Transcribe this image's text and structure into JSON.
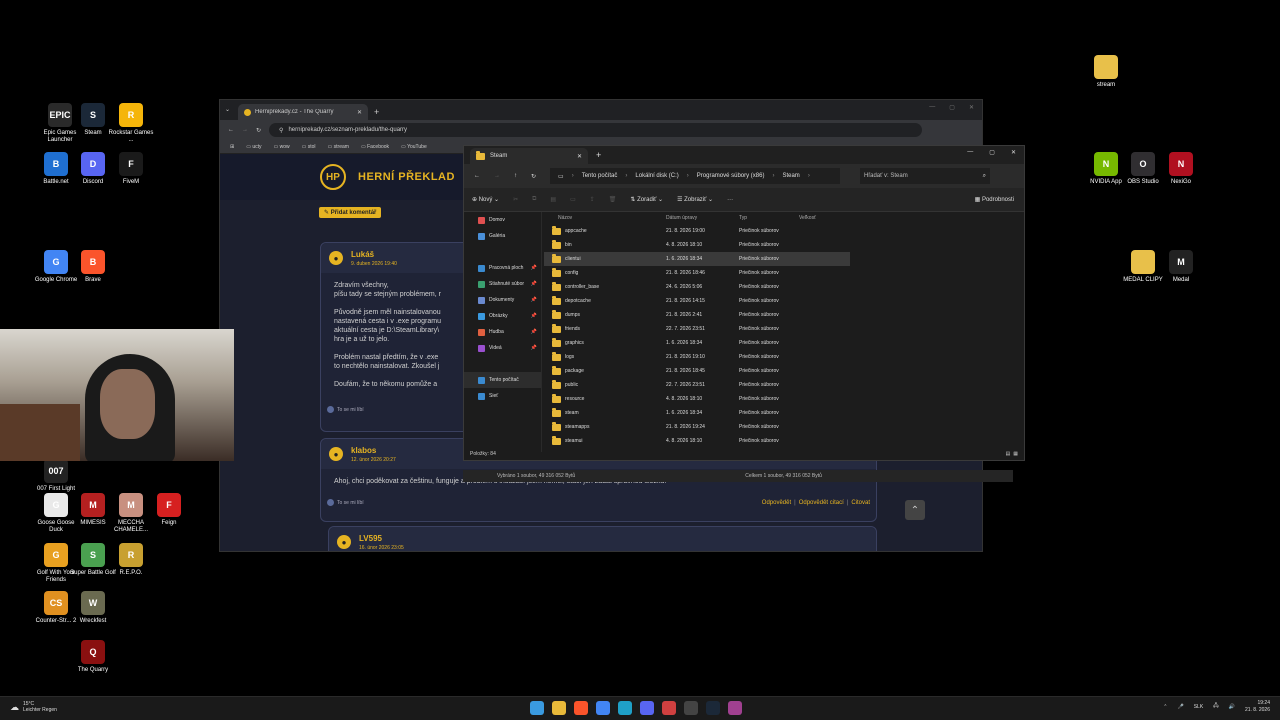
{
  "desktop": {
    "icons_left": [
      {
        "label": "Epic Games Launcher",
        "color": "#2a2a2a",
        "glyph": "EPIC"
      },
      {
        "label": "Steam",
        "color": "#1b2838",
        "glyph": "S"
      },
      {
        "label": "Rockstar Games ...",
        "color": "#f5b50a",
        "glyph": "R"
      },
      {
        "label": "Battle.net",
        "color": "#1f6fd1",
        "glyph": "B"
      },
      {
        "label": "Discord",
        "color": "#5865f2",
        "glyph": "D"
      },
      {
        "label": "FiveM",
        "color": "#1a1a1a",
        "glyph": "F"
      },
      {
        "label": "Google Chrome",
        "color": "#4285f4",
        "glyph": "G"
      },
      {
        "label": "Brave",
        "color": "#fb542b",
        "glyph": "B"
      },
      {
        "label": "007 First Light",
        "color": "#222",
        "glyph": "007"
      },
      {
        "label": "Goose Goose Duck",
        "color": "#e9e9e9",
        "glyph": "G"
      },
      {
        "label": "MIMESIS",
        "color": "#b52020",
        "glyph": "M"
      },
      {
        "label": "MECCHA CHAMELE...",
        "color": "#c89080",
        "glyph": "M"
      },
      {
        "label": "Feign",
        "color": "#d62020",
        "glyph": "F"
      },
      {
        "label": "Golf With Your Friends",
        "color": "#e8a020",
        "glyph": "G"
      },
      {
        "label": "Super Battle Golf",
        "color": "#4aa050",
        "glyph": "S"
      },
      {
        "label": "R.E.P.O.",
        "color": "#c8a030",
        "glyph": "R"
      },
      {
        "label": "Counter-Str... 2",
        "color": "#e09020",
        "glyph": "CS"
      },
      {
        "label": "Wreckfest",
        "color": "#6a6a50",
        "glyph": "W"
      },
      {
        "label": "The Quarry",
        "color": "#8a1010",
        "glyph": "Q"
      }
    ],
    "icons_right": [
      {
        "label": "stream",
        "color": "#e8c04a",
        "glyph": ""
      },
      {
        "label": "NVIDIA App",
        "color": "#76b900",
        "glyph": "N"
      },
      {
        "label": "OBS Studio",
        "color": "#302e31",
        "glyph": "O"
      },
      {
        "label": "NexiGo",
        "color": "#b01020",
        "glyph": "N"
      },
      {
        "label": "MEDAL CLIPY",
        "color": "#e8c04a",
        "glyph": ""
      },
      {
        "label": "Medal",
        "color": "#222",
        "glyph": "M"
      }
    ]
  },
  "browser": {
    "tab_title": "Herniprekady.cz - The Quarry",
    "url": "herniprekady.cz/seznam-prekladu/the-quarry",
    "bookmarks": [
      "ucty",
      "wow",
      "stol",
      "stream",
      "Facebook",
      "YouTube"
    ],
    "site_logo": "HP",
    "site_title": "HERNÍ PŘEKLAD",
    "add_comment": "Přidat komentář",
    "comments": [
      {
        "author": "Lukáš",
        "date": "9. duben 2026 19:40",
        "paragraphs": [
          "Zdravím všechny,",
          "píšu tady se stejným problémem, r",
          "Původně jsem měl nainstalovanou",
          "nastavená cesta i v .exe programu",
          "aktuální cesta je D:\\SteamLibrary\\",
          "hra je a už to jelo.",
          "Problém nastal předtím, že v .exe",
          "to nechtělo nainstalovat. Zkoušel j",
          "Doufám, že to někomu pomůže a"
        ],
        "like": "To se mi líbí"
      },
      {
        "author": "klabos",
        "date": "12. únor 2026 20:27",
        "paragraphs": [
          "Ahoj, chci poděkovat za češtinu, funguje a problém s instalací jsem neměl, stačí jen zadat správnou složku."
        ],
        "like": "To se mi líbí",
        "actions": [
          "Odpovědět",
          "Odpovědět citací",
          "Citovat"
        ]
      },
      {
        "author": "LV595",
        "date": "16. únor 2026 23:05"
      }
    ]
  },
  "explorer": {
    "tab_title": "Steam",
    "breadcrumb": [
      "Tento počítač",
      "Lokální disk (C:)",
      "Programové súbory (x86)",
      "Steam"
    ],
    "search_placeholder": "Hľadať v: Steam",
    "toolbar": {
      "new": "Nový",
      "sort": "Zoradiť",
      "view": "Zobraziť",
      "more": "···",
      "details": "Podrobnosti"
    },
    "sidebar": [
      {
        "label": "Domov",
        "color": "#e05050"
      },
      {
        "label": "Galéria",
        "color": "#4a90d9"
      },
      {
        "label": "Pracovná ploch",
        "color": "#3a8ad0",
        "pin": true
      },
      {
        "label": "Stiahnuté súbor",
        "color": "#3aa070",
        "pin": true
      },
      {
        "label": "Dokumenty",
        "color": "#6a8ad0",
        "pin": true
      },
      {
        "label": "Obrázky",
        "color": "#3a9ae0",
        "pin": true
      },
      {
        "label": "Hudba",
        "color": "#e06040",
        "pin": true
      },
      {
        "label": "Videá",
        "color": "#9a50d0",
        "pin": true
      },
      {
        "label": "Tento počítač",
        "color": "#3a8ad0"
      },
      {
        "label": "Sieť",
        "color": "#3a8ad0"
      }
    ],
    "columns": [
      "Názov",
      "Dátum úpravy",
      "Typ",
      "Veľkosť"
    ],
    "rows": [
      {
        "name": "appcache",
        "date": "21. 8. 2026 19:00",
        "type": "Priečinok súborov"
      },
      {
        "name": "bin",
        "date": "4. 8. 2026 18:10",
        "type": "Priečinok súborov"
      },
      {
        "name": "clientui",
        "date": "1. 6. 2026 18:34",
        "type": "Priečinok súborov",
        "selected": true
      },
      {
        "name": "config",
        "date": "21. 8. 2026 18:46",
        "type": "Priečinok súborov"
      },
      {
        "name": "controller_base",
        "date": "24. 6. 2026 5:06",
        "type": "Priečinok súborov"
      },
      {
        "name": "depotcache",
        "date": "21. 8. 2026 14:15",
        "type": "Priečinok súborov"
      },
      {
        "name": "dumps",
        "date": "21. 8. 2026 2:41",
        "type": "Priečinok súborov"
      },
      {
        "name": "friends",
        "date": "22. 7. 2026 23:51",
        "type": "Priečinok súborov"
      },
      {
        "name": "graphics",
        "date": "1. 6. 2026 18:34",
        "type": "Priečinok súborov"
      },
      {
        "name": "logs",
        "date": "21. 8. 2026 19:10",
        "type": "Priečinok súborov"
      },
      {
        "name": "package",
        "date": "21. 8. 2026 18:45",
        "type": "Priečinok súborov"
      },
      {
        "name": "public",
        "date": "22. 7. 2026 23:51",
        "type": "Priečinok súborov"
      },
      {
        "name": "resource",
        "date": "4. 8. 2026 18:10",
        "type": "Priečinok súborov"
      },
      {
        "name": "steam",
        "date": "1. 6. 2026 18:34",
        "type": "Priečinok súborov"
      },
      {
        "name": "steamapps",
        "date": "21. 8. 2026 19:24",
        "type": "Priečinok súborov"
      },
      {
        "name": "steamui",
        "date": "4. 8. 2026 18:10",
        "type": "Priečinok súborov"
      }
    ],
    "status_items": "Položky: 84",
    "status_selected": "Vybráno 1 soubor, 49 316 052 Bytů",
    "status_total": "Celkem 1 soubor, 49 316 052 Bytů"
  },
  "taskbar": {
    "temp": "15°C",
    "weather": "Leichter Regen",
    "lang": "SLK",
    "time": "19:24",
    "date": "21. 8. 2026",
    "apps": [
      {
        "name": "windows",
        "color": "#3a9ae0"
      },
      {
        "name": "explorer",
        "color": "#e8b93a"
      },
      {
        "name": "brave",
        "color": "#fb542b"
      },
      {
        "name": "chrome",
        "color": "#4285f4"
      },
      {
        "name": "edge",
        "color": "#1fa0c8"
      },
      {
        "name": "discord",
        "color": "#5865f2"
      },
      {
        "name": "snipping",
        "color": "#d04040"
      },
      {
        "name": "obs",
        "color": "#444"
      },
      {
        "name": "steam",
        "color": "#1b2838"
      },
      {
        "name": "winrar",
        "color": "#a04090"
      }
    ]
  }
}
